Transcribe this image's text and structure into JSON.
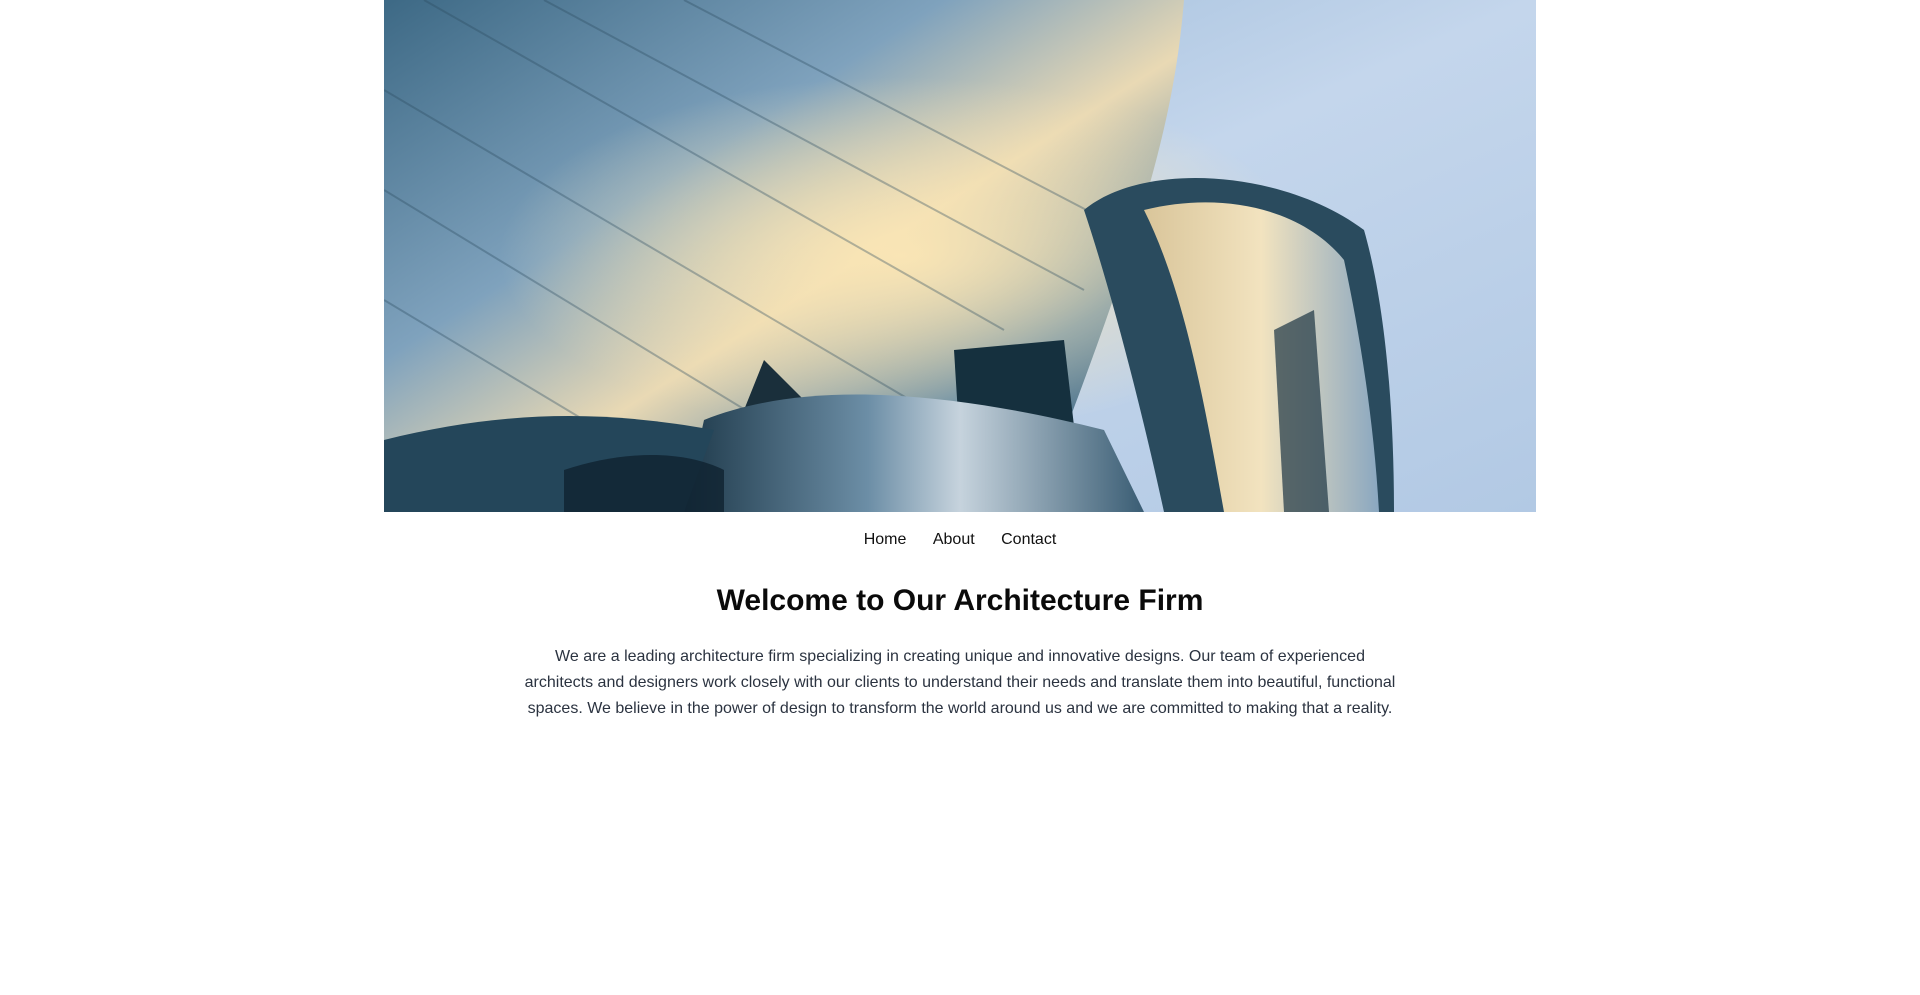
{
  "hero": {
    "image_name": "architecture-building-photo",
    "colors": {
      "sky": "#c4d6ec",
      "steel": "#5e88a8",
      "shadow": "#1d3443",
      "highlight": "#f3dfae"
    }
  },
  "nav": {
    "items": [
      {
        "label": "Home"
      },
      {
        "label": "About"
      },
      {
        "label": "Contact"
      }
    ]
  },
  "main": {
    "title": "Welcome to Our Architecture Firm",
    "intro": "We are a leading architecture firm specializing in creating unique and innovative designs. Our team of experienced architects and designers work closely with our clients to understand their needs and translate them into beautiful, functional spaces. We believe in the power of design to transform the world around us and we are committed to making that a reality."
  }
}
